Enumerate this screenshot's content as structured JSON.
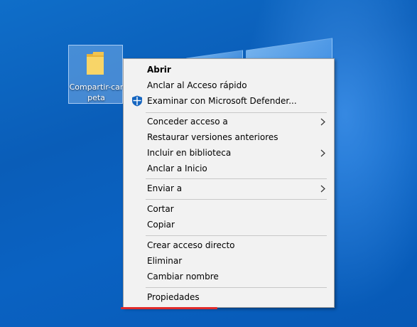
{
  "desktop": {
    "icon_label": "Compartir-carpeta"
  },
  "context_menu": {
    "items": [
      {
        "label": "Abrir",
        "bold": true
      },
      {
        "label": "Anclar al Acceso rápido"
      },
      {
        "label": "Examinar con Microsoft Defender...",
        "icon": "defender-shield-icon"
      },
      {
        "label": "Conceder acceso a",
        "submenu": true
      },
      {
        "label": "Restaurar versiones anteriores"
      },
      {
        "label": "Incluir en biblioteca",
        "submenu": true
      },
      {
        "label": "Anclar a Inicio"
      },
      {
        "label": "Enviar a",
        "submenu": true
      },
      {
        "label": "Cortar"
      },
      {
        "label": "Copiar"
      },
      {
        "label": "Crear acceso directo"
      },
      {
        "label": "Eliminar"
      },
      {
        "label": "Cambiar nombre"
      },
      {
        "label": "Propiedades"
      }
    ]
  },
  "colors": {
    "desktop_blue": "#0a62c2",
    "menu_bg": "#f2f2f2",
    "highlight_underline": "#e02b2b",
    "defender_blue": "#1565c0"
  }
}
